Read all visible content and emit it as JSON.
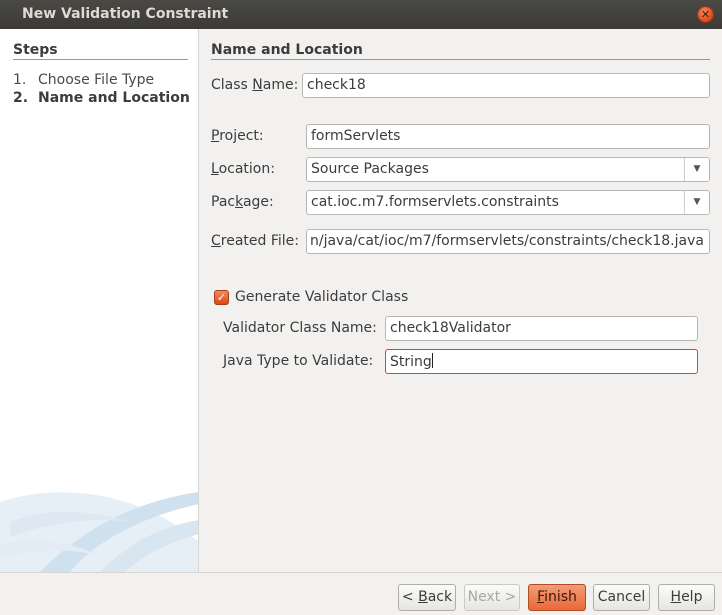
{
  "window": {
    "title": "New Validation Constraint"
  },
  "steps": {
    "heading": "Steps",
    "items": [
      {
        "num": "1.",
        "label": "Choose File Type"
      },
      {
        "num": "2.",
        "label": "Name and Location"
      }
    ]
  },
  "section": {
    "heading": "Name and Location"
  },
  "form": {
    "class_name": {
      "label_pre": "Class ",
      "label_u": "N",
      "label_post": "ame:",
      "value": "check18"
    },
    "project": {
      "label_pre": "",
      "label_u": "P",
      "label_post": "roject:",
      "value": "formServlets"
    },
    "location": {
      "label_pre": "",
      "label_u": "L",
      "label_post": "ocation:",
      "value": "Source Packages"
    },
    "package": {
      "label_pre": "Pac",
      "label_u": "k",
      "label_post": "age:",
      "value": "cat.ioc.m7.formservlets.constraints"
    },
    "created_file": {
      "label_pre": "",
      "label_u": "C",
      "label_post": "reated File:",
      "value": "n/java/cat/ioc/m7/formservlets/constraints/check18.java"
    },
    "generate_validator": {
      "label": "Generate Validator Class",
      "checked": true
    },
    "validator_class_name": {
      "label": "Validator Class Name:",
      "value": "check18Validator"
    },
    "java_type": {
      "label": "Java Type to Validate:",
      "value": "String"
    }
  },
  "buttons": {
    "back": {
      "pre": "< ",
      "u": "B",
      "post": "ack"
    },
    "next": {
      "label": "Next >"
    },
    "finish": {
      "pre": "",
      "u": "F",
      "post": "inish"
    },
    "cancel": {
      "label": "Cancel"
    },
    "help": {
      "pre": "",
      "u": "H",
      "post": "elp"
    }
  },
  "colors": {
    "accent": "#dd4814",
    "titlebar": "#3c3b37"
  }
}
